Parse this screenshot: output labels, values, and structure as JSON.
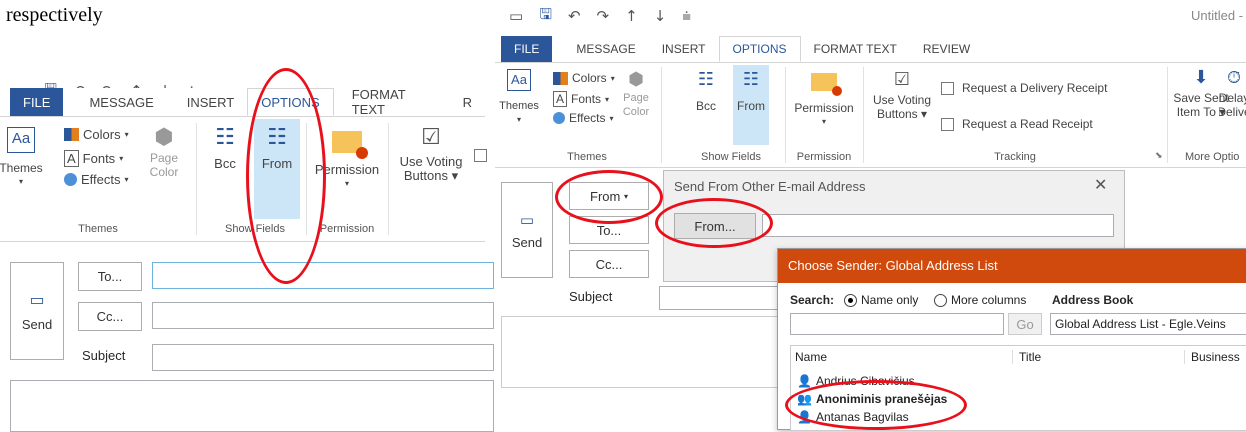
{
  "caption": "respectively",
  "left": {
    "qat": {
      "icons": [
        "draft-icon",
        "save-icon",
        "undo-icon",
        "redo-icon",
        "up-arrow-icon",
        "down-arrow-icon",
        "customize-icon"
      ]
    },
    "tabs": [
      "FILE",
      "MESSAGE",
      "INSERT",
      "OPTIONS",
      "FORMAT TEXT",
      "R"
    ],
    "themes": {
      "themes_label": "Themes",
      "colors_label": "Colors",
      "fonts_label": "Fonts",
      "effects_label": "Effects",
      "page_label": "Page",
      "page_color_label": "Color",
      "group_label": "Themes"
    },
    "showfields": {
      "bcc_label": "Bcc",
      "from_label": "From",
      "group_label": "Show Fields"
    },
    "permission": {
      "label": "Permission",
      "group_label": "Permission"
    },
    "voting": {
      "label1": "Use Voting",
      "label2": "Buttons"
    },
    "compose": {
      "send_label": "Send",
      "to_label": "To...",
      "cc_label": "Cc...",
      "subject_label": "Subject"
    }
  },
  "right": {
    "title": "Untitled -",
    "tabs": [
      "FILE",
      "MESSAGE",
      "INSERT",
      "OPTIONS",
      "FORMAT TEXT",
      "REVIEW"
    ],
    "themes": {
      "themes_label": "Themes",
      "colors_label": "Colors",
      "fonts_label": "Fonts",
      "effects_label": "Effects",
      "page_label": "Page",
      "page_color_label": "Color",
      "group_label": "Themes"
    },
    "showfields": {
      "bcc_label": "Bcc",
      "from_label": "From",
      "group_label": "Show Fields"
    },
    "permission": {
      "label": "Permission",
      "group_label": "Permission"
    },
    "tracking": {
      "voting1": "Use Voting",
      "voting2": "Buttons",
      "delivery_receipt": "Request a Delivery Receipt",
      "read_receipt": "Request a Read Receipt",
      "group_label": "Tracking"
    },
    "more_options": {
      "save_sent1": "Save Sent",
      "save_sent2": "Item To",
      "delay1": "Delay",
      "delay2": "Delive",
      "group_label": "More Optio"
    },
    "compose": {
      "send_label": "Send",
      "from_label": "From",
      "to_label": "To...",
      "cc_label": "Cc...",
      "subject_label": "Subject"
    },
    "send_from_dialog": {
      "title": "Send From Other E-mail Address",
      "from_button": "From..."
    },
    "gal_dialog": {
      "title": "Choose Sender: Global Address List",
      "search_label": "Search:",
      "radio_name_only": "Name only",
      "radio_more_columns": "More columns",
      "address_book_label": "Address Book",
      "go_button": "Go",
      "address_book_value": "Global Address List - Egle.Veins",
      "columns": [
        "Name",
        "Title",
        "Business"
      ],
      "rows": [
        {
          "name": "Andrius Cibavičius",
          "bold": false
        },
        {
          "name": "Anoniminis pranešėjas",
          "bold": true
        },
        {
          "name": "Antanas Bagvilas",
          "bold": false
        }
      ]
    }
  },
  "colors": {
    "file_tab": "#2b579a",
    "gal_title": "#cf4a0c",
    "highlight": "#cde6f7",
    "annotation": "#e8101b"
  }
}
